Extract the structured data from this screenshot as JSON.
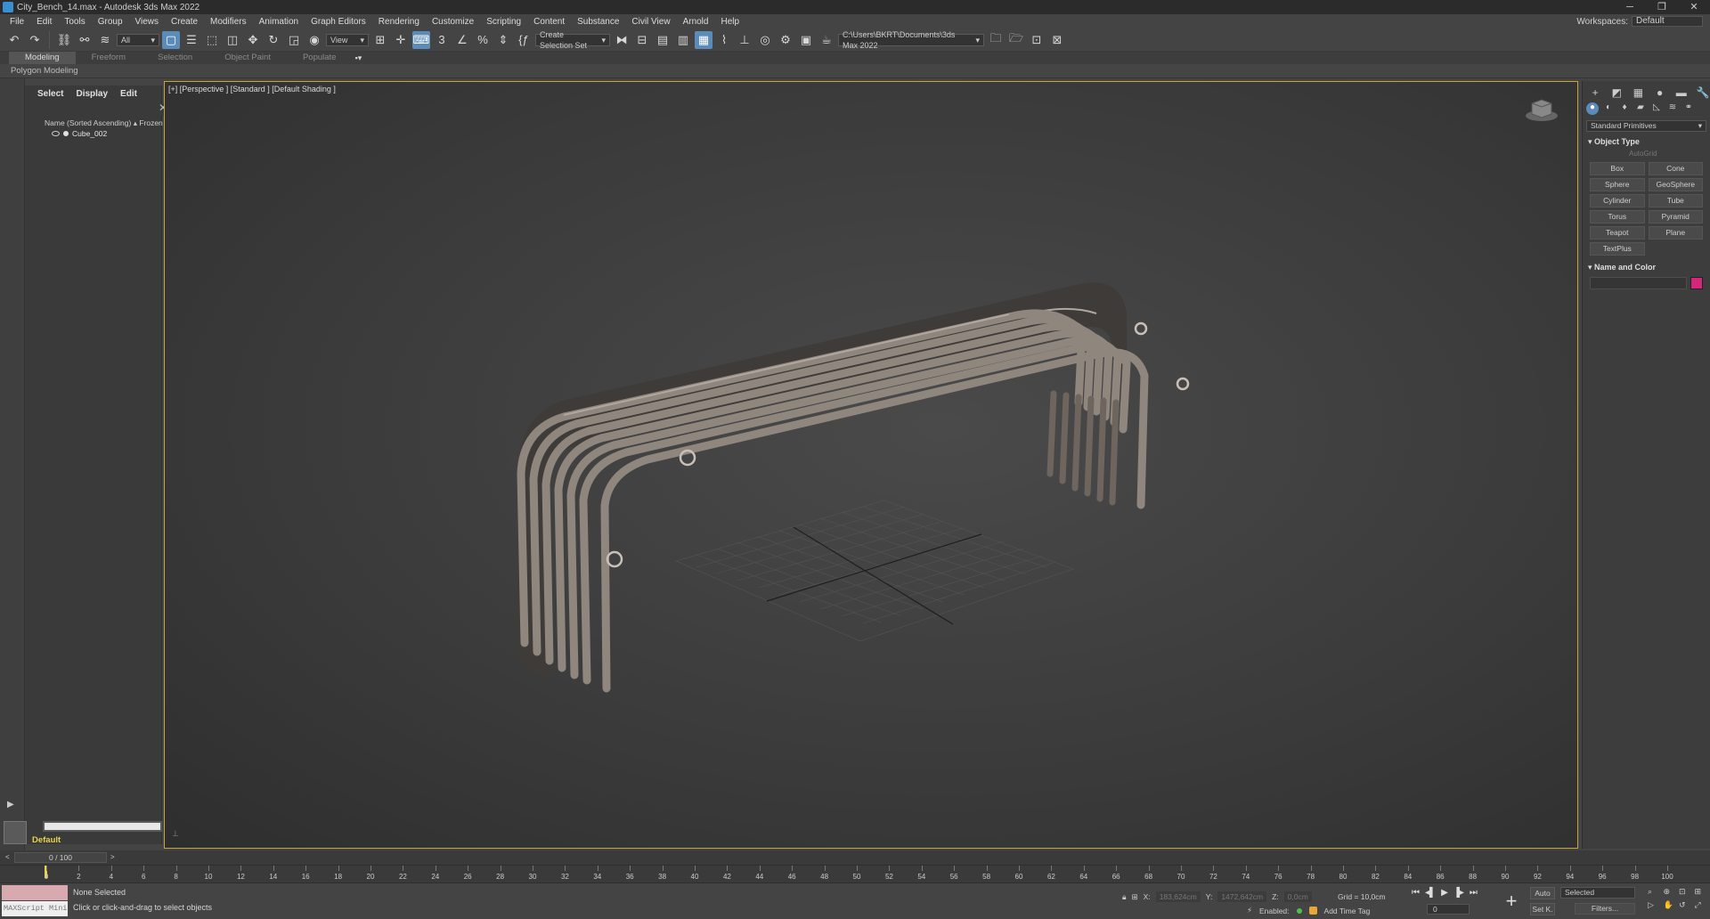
{
  "window": {
    "title": "City_Bench_14.max - Autodesk 3ds Max 2022",
    "minimize": "─",
    "maximize": "❐",
    "close": "✕"
  },
  "menu": [
    "File",
    "Edit",
    "Tools",
    "Group",
    "Views",
    "Create",
    "Modifiers",
    "Animation",
    "Graph Editors",
    "Rendering",
    "Customize",
    "Scripting",
    "Content",
    "Substance",
    "Civil View",
    "Arnold",
    "Help"
  ],
  "workspace": {
    "label": "Workspaces:",
    "value": "Default"
  },
  "toolbar": {
    "selection_filter": "All",
    "ref_coord": "View",
    "named_selection": "Create Selection Set",
    "project_path": "C:\\Users\\BKRT\\Documents\\3ds Max 2022"
  },
  "ribbon": {
    "tabs": [
      "Modeling",
      "Freeform",
      "Selection",
      "Object Paint",
      "Populate"
    ],
    "active_tab": "Modeling",
    "panel": "Polygon Modeling"
  },
  "explorer": {
    "tabs": [
      "Select",
      "Display",
      "Edit"
    ],
    "header": "Name (Sorted Ascending) ▴ Frozen",
    "object": "Cube_002",
    "layer": "Default"
  },
  "viewport": {
    "label": "[+] [Perspective ] [Standard ] [Default Shading ]"
  },
  "command_panel": {
    "category": "Standard Primitives",
    "object_type_title": "Object Type",
    "autogrid": "AutoGrid",
    "primitives": [
      "Box",
      "Cone",
      "Sphere",
      "GeoSphere",
      "Cylinder",
      "Tube",
      "Torus",
      "Pyramid",
      "Teapot",
      "Plane",
      "TextPlus"
    ],
    "name_color_title": "Name and Color",
    "object_color": "#d4267a"
  },
  "timeline": {
    "frame_display": "0 / 100",
    "ticks": [
      "0",
      "2",
      "4",
      "6",
      "8",
      "10",
      "12",
      "14",
      "16",
      "18",
      "20",
      "22",
      "24",
      "26",
      "28",
      "30",
      "32",
      "34",
      "36",
      "38",
      "40",
      "42",
      "44",
      "46",
      "48",
      "50",
      "52",
      "54",
      "56",
      "58",
      "60",
      "62",
      "64",
      "66",
      "68",
      "70",
      "72",
      "74",
      "76",
      "78",
      "80",
      "82",
      "84",
      "86",
      "88",
      "90",
      "92",
      "94",
      "96",
      "98",
      "100"
    ]
  },
  "status": {
    "maxscript": "MAXScript Mini",
    "selection": "None Selected",
    "prompt": "Click or click-and-drag to select objects",
    "x_label": "X:",
    "x_value": "183,624cm",
    "y_label": "Y:",
    "y_value": "1472,642cm",
    "z_label": "Z:",
    "z_value": "0,0cm",
    "grid": "Grid = 10,0cm",
    "enabled": "Enabled:",
    "add_time_tag": "Add Time Tag",
    "auto": "Auto",
    "set_key": "Set K.",
    "selected": "Selected",
    "filters": "Filters...",
    "frame_field": "0"
  }
}
